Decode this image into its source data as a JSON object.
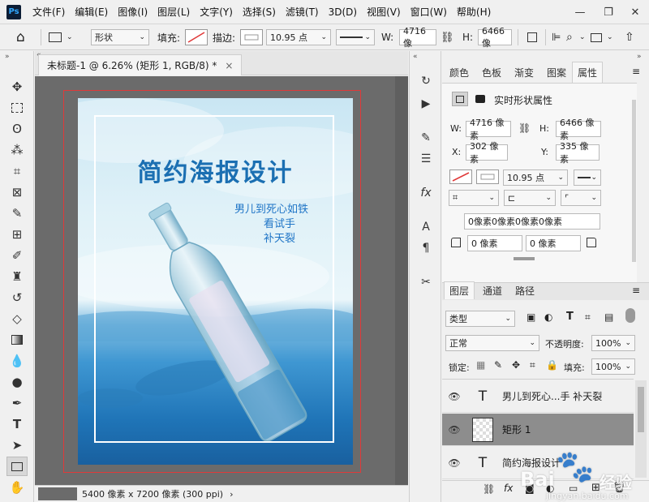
{
  "menu": {
    "logo": "Ps",
    "items": [
      "文件(F)",
      "编辑(E)",
      "图像(I)",
      "图层(L)",
      "文字(Y)",
      "选择(S)",
      "滤镜(T)",
      "3D(D)",
      "视图(V)",
      "窗口(W)",
      "帮助(H)"
    ]
  },
  "window_controls": {
    "minimize": "—",
    "restore": "❐",
    "close": "✕"
  },
  "options": {
    "mode": "形状",
    "fill_label": "填充:",
    "stroke_label": "描边:",
    "stroke_size": "10.95 点",
    "w_label": "W:",
    "w_value": "4716 像",
    "h_label": "H:",
    "h_value": "6466 像"
  },
  "document": {
    "tab_title": "未标题-1 @ 6.26% (矩形 1, RGB/8) *",
    "tab_close": "×",
    "status": "5400 像素 x 7200 像素 (300 ppi)",
    "status_arrow": "›"
  },
  "poster": {
    "title": "简约海报设计",
    "lines": [
      "男儿到死心如铁",
      "看试手",
      "补天裂"
    ]
  },
  "properties": {
    "tabs": [
      "颜色",
      "色板",
      "渐变",
      "图案",
      "属性"
    ],
    "active_tab": "属性",
    "header": "实时形状属性",
    "w_label": "W:",
    "w_value": "4716 像素",
    "h_label": "H:",
    "h_value": "6466 像素",
    "x_label": "X:",
    "x_value": "302 像素",
    "y_label": "Y:",
    "y_value": "335 像素",
    "stroke_size": "10.95 点",
    "corners": "0像素0像素0像素0像素",
    "corner_a": "0 像素",
    "corner_b": "0 像素"
  },
  "layers": {
    "tabs": [
      "图层",
      "通道",
      "路径"
    ],
    "active_tab": "图层",
    "filter_kind": "类型",
    "blend_mode": "正常",
    "opacity_label": "不透明度:",
    "opacity": "100%",
    "lock_label": "锁定:",
    "fill_label": "填充:",
    "fill": "100%",
    "rows": [
      {
        "type": "T",
        "name": "男儿到死心...手 补天裂",
        "selected": false
      },
      {
        "type": "shape",
        "name": "矩形 1",
        "selected": true
      },
      {
        "type": "T",
        "name": "简约海报设计",
        "selected": false
      }
    ]
  },
  "watermark": {
    "brand": "Bai",
    "paw": "经验",
    "url": "jingyan.baidu.com"
  },
  "colors": {
    "accent_red": "#e03a3a",
    "selected_layer": "#8d8d8d",
    "poster_title": "#1b6fb2"
  }
}
